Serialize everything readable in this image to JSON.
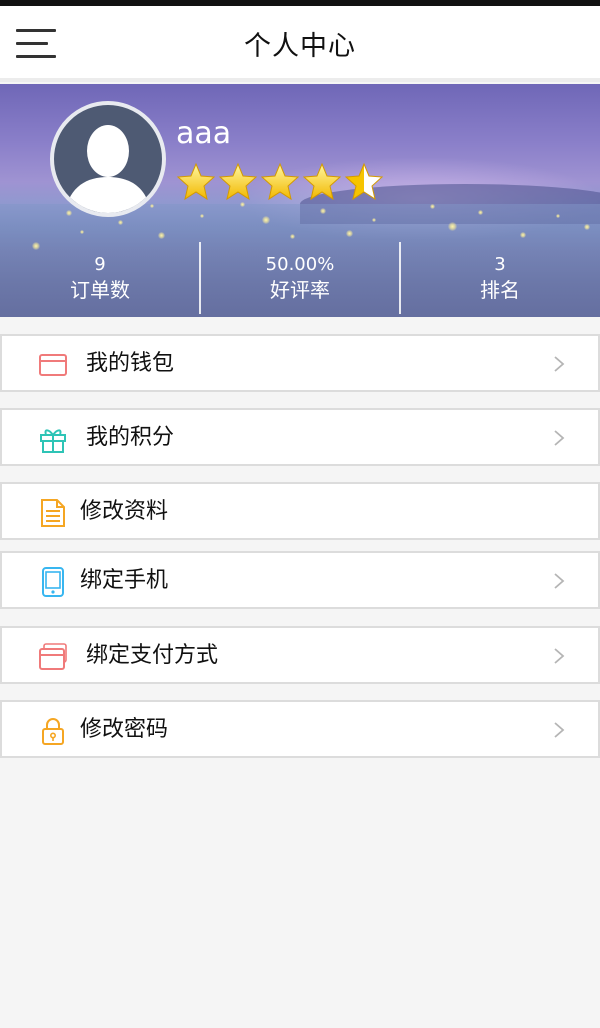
{
  "header": {
    "title": "个人中心"
  },
  "profile": {
    "username": "aaa",
    "rating_stars": 4.5,
    "rating_max": 5,
    "stats": [
      {
        "value": "9",
        "label": "订单数"
      },
      {
        "value": "50.00%",
        "label": "好评率"
      },
      {
        "value": "3",
        "label": "排名"
      }
    ]
  },
  "menu": [
    {
      "label": "我的钱包",
      "icon": "wallet-icon",
      "color": "#f07a7a",
      "has_chevron": true
    },
    {
      "label": "我的积分",
      "icon": "gift-icon",
      "color": "#2ec4b6",
      "has_chevron": true
    },
    {
      "label": "修改资料",
      "icon": "document-icon",
      "color": "#f5a623",
      "has_chevron": false
    },
    {
      "label": "绑定手机",
      "icon": "phone-icon",
      "color": "#38b6f0",
      "has_chevron": true
    },
    {
      "label": "绑定支付方式",
      "icon": "card-icon",
      "color": "#f07a7a",
      "has_chevron": true
    },
    {
      "label": "修改密码",
      "icon": "lock-icon",
      "color": "#f5a623",
      "has_chevron": true
    }
  ]
}
